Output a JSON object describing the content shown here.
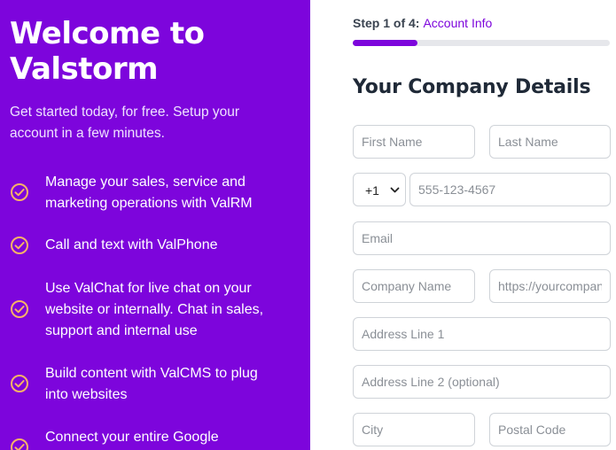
{
  "left": {
    "title": "Welcome to Valstorm",
    "subtitle": "Get started today, for free. Setup your account in a few minutes.",
    "check_icon": "check-circle-icon",
    "check_color": "#f7b267",
    "background": "#7d05dc",
    "features": [
      "Manage your sales, service and marketing operations with ValRM",
      "Call and text with ValPhone",
      "Use ValChat for live chat on your website or internally. Chat in sales, support and internal use",
      "Build content with ValCMS to plug into websites",
      "Connect your entire Google"
    ]
  },
  "form": {
    "step_label": "Step 1 of 4:",
    "step_current": "Account Info",
    "progress_fraction": 0.25,
    "heading": "Your Company Details",
    "first_name_placeholder": "First Name",
    "last_name_placeholder": "Last Name",
    "country_code": "+1",
    "phone_placeholder": "555-123-4567",
    "email_placeholder": "Email",
    "company_name_placeholder": "Company Name",
    "website_placeholder": "https://yourcompany.com",
    "address1_placeholder": "Address Line 1",
    "address2_placeholder": "Address Line 2 (optional)",
    "city_placeholder": "City",
    "postal_placeholder": "Postal Code"
  }
}
